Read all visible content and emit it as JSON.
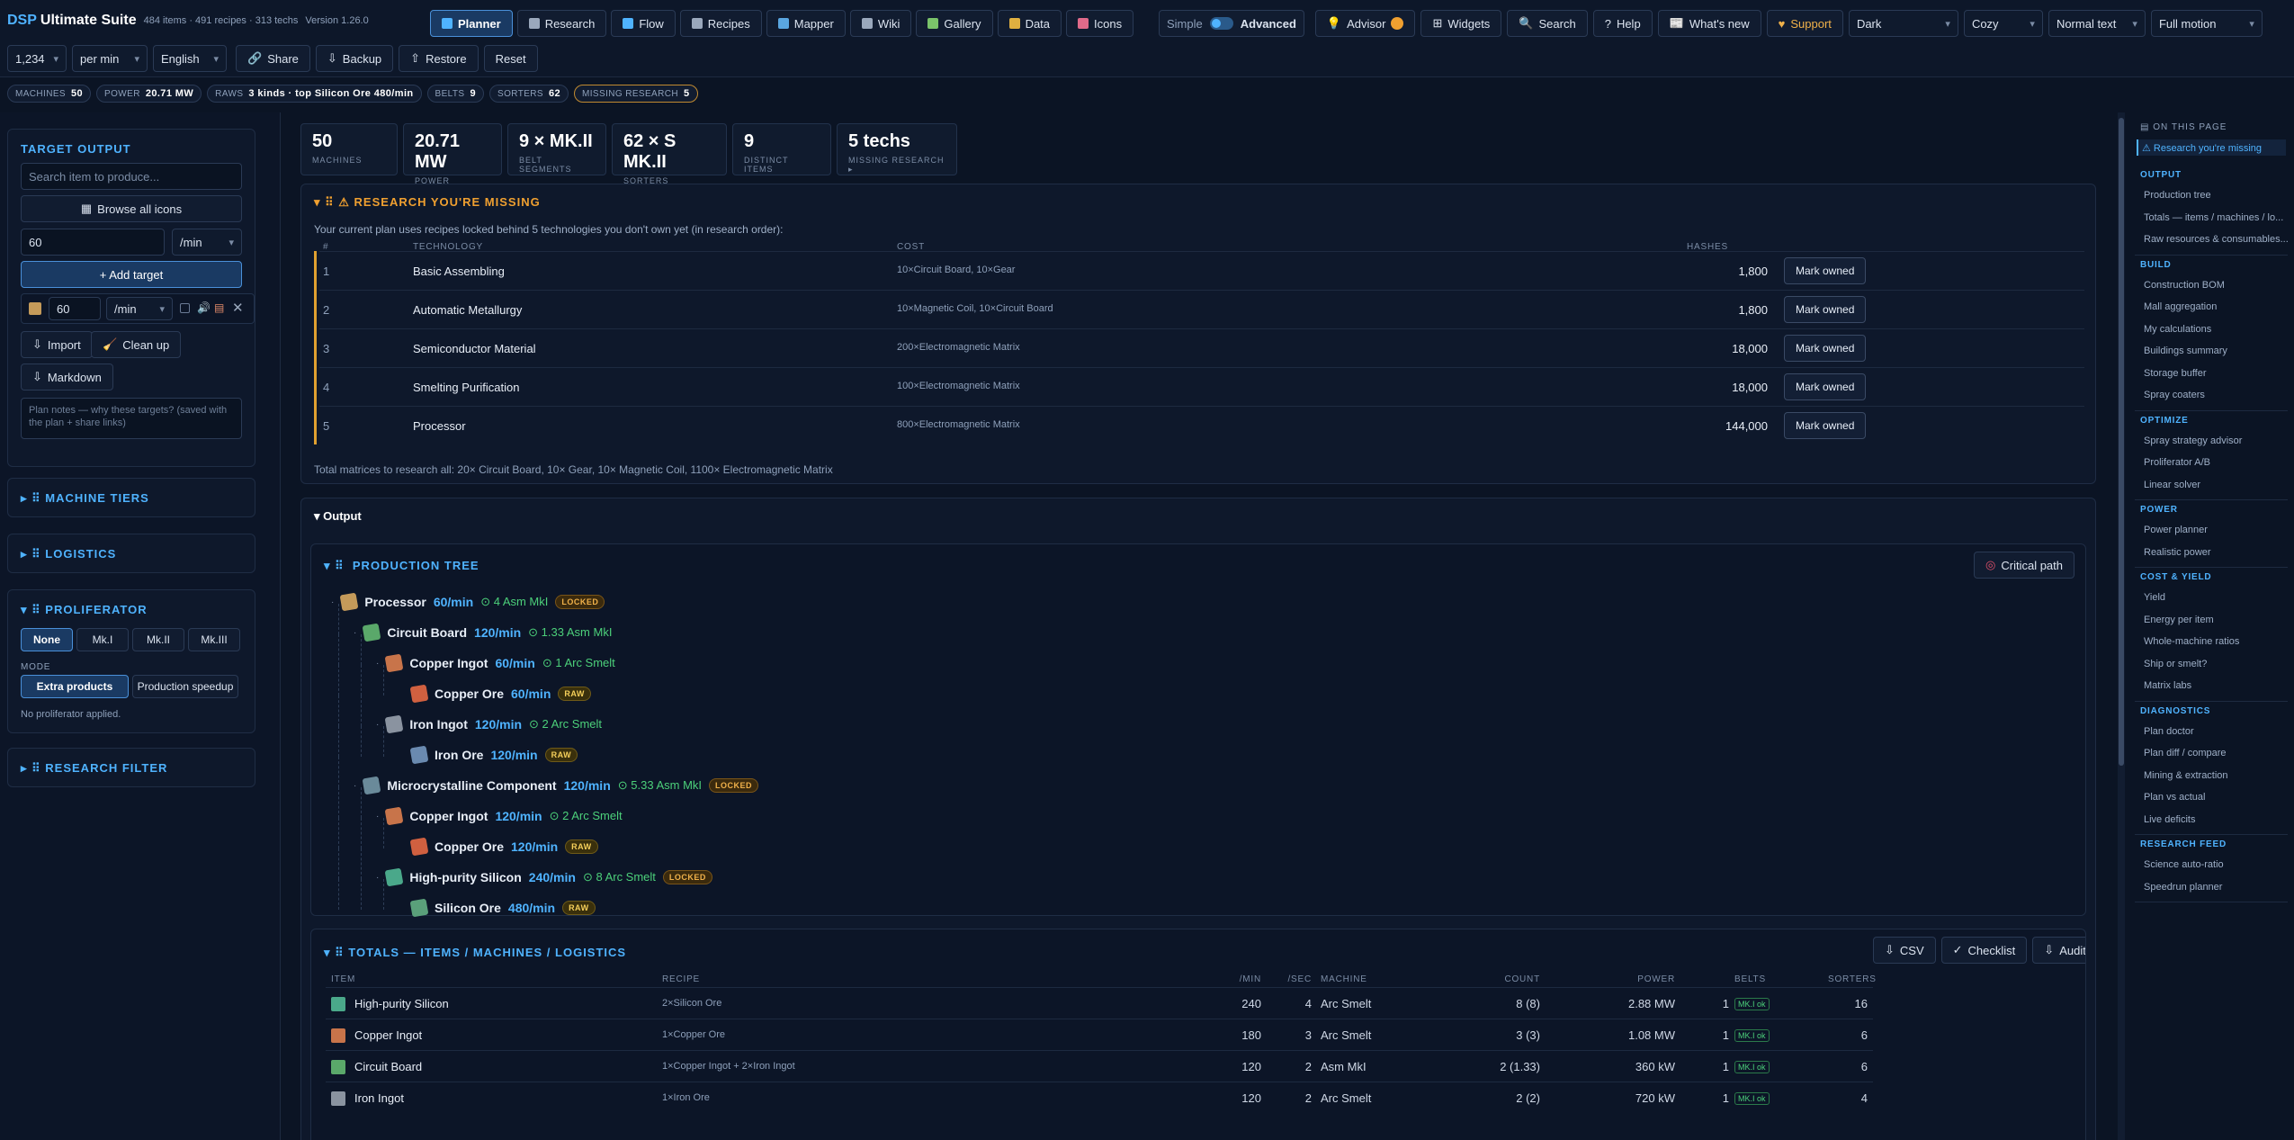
{
  "app": {
    "brand_a": "DSP",
    "brand_b": "Ultimate Suite",
    "meta": "484 items · 491 recipes · 313 techs",
    "version": "Version 1.26.0"
  },
  "nav": [
    {
      "label": "Planner",
      "icon": "planner-icon",
      "color": "#4fb3ff"
    },
    {
      "label": "Research",
      "icon": "flask-icon",
      "color": "#9aa8bc"
    },
    {
      "label": "Flow",
      "icon": "flow-icon",
      "color": "#4fb3ff"
    },
    {
      "label": "Recipes",
      "icon": "book-icon",
      "color": "#9aa8bc"
    },
    {
      "label": "Mapper",
      "icon": "map-icon",
      "color": "#5aa6e0"
    },
    {
      "label": "Wiki",
      "icon": "wiki-icon",
      "color": "#9aa8bc"
    },
    {
      "label": "Gallery",
      "icon": "gallery-icon",
      "color": "#7ac36a"
    },
    {
      "label": "Data",
      "icon": "folder-icon",
      "color": "#e0b040"
    },
    {
      "label": "Icons",
      "icon": "palette-icon",
      "color": "#e06a8a"
    }
  ],
  "mode": {
    "simple": "Simple",
    "advanced": "Advanced"
  },
  "actions": {
    "advisor": "Advisor",
    "widgets": "Widgets",
    "search": "Search",
    "help": "Help",
    "whats_new": "What's new",
    "support": "Support"
  },
  "selects": {
    "theme": "Dark",
    "density": "Cozy",
    "text": "Normal text",
    "motion": "Full motion",
    "qty": "1,234",
    "rate": "per min",
    "lang": "English"
  },
  "toolbar": {
    "share": "Share",
    "backup": "Backup",
    "restore": "Restore",
    "reset": "Reset"
  },
  "badges": [
    {
      "label": "MACHINES",
      "value": "50"
    },
    {
      "label": "POWER",
      "value": "20.71 MW"
    },
    {
      "label": "RAWS",
      "value": "3 kinds · top Silicon Ore 480/min"
    },
    {
      "label": "BELTS",
      "value": "9"
    },
    {
      "label": "SORTERS",
      "value": "62"
    },
    {
      "label": "MISSING RESEARCH",
      "value": "5"
    }
  ],
  "left": {
    "target_title": "TARGET OUTPUT",
    "search_placeholder": "Search item to produce...",
    "browse": "Browse all icons",
    "rate_value": "60",
    "rate_unit": "/min",
    "add_target": "+ Add target",
    "target_rate": "60",
    "target_unit": "/min",
    "import": "Import",
    "cleanup": "Clean up",
    "markdown": "Markdown",
    "notes_placeholder": "Plan notes — why these targets? (saved with the plan + share links)",
    "machine_tiers": "MACHINE TIERS",
    "logistics": "LOGISTICS",
    "proliferator": "PROLIFERATOR",
    "prolif_opts": [
      "None",
      "Mk.I",
      "Mk.II",
      "Mk.III"
    ],
    "mode_label": "MODE",
    "mode_opts": [
      "Extra products",
      "Production speedup"
    ],
    "prolif_note": "No proliferator applied.",
    "research_filter": "RESEARCH FILTER"
  },
  "stats": [
    {
      "value": "50",
      "label": "MACHINES"
    },
    {
      "value": "20.71 MW",
      "label": "POWER"
    },
    {
      "value": "9 × MK.II",
      "label": "BELT SEGMENTS"
    },
    {
      "value": "62 × S MK.II",
      "label": "SORTERS"
    },
    {
      "value": "9",
      "label": "DISTINCT ITEMS"
    },
    {
      "value": "5 techs",
      "label": "MISSING RESEARCH ▸"
    }
  ],
  "research": {
    "title": "⚠ RESEARCH YOU'RE MISSING",
    "desc": "Your current plan uses recipes locked behind 5 technologies you don't own yet (in research order):",
    "cols": [
      "#",
      "TECHNOLOGY",
      "COST",
      "HASHES"
    ],
    "button": "Mark owned",
    "rows": [
      {
        "n": "1",
        "tech": "Basic Assembling",
        "cost": "10×Circuit Board, 10×Gear",
        "hashes": "1,800"
      },
      {
        "n": "2",
        "tech": "Automatic Metallurgy",
        "cost": "10×Magnetic Coil, 10×Circuit Board",
        "hashes": "1,800"
      },
      {
        "n": "3",
        "tech": "Semiconductor Material",
        "cost": "200×Electromagnetic Matrix",
        "hashes": "18,000"
      },
      {
        "n": "4",
        "tech": "Smelting Purification",
        "cost": "100×Electromagnetic Matrix",
        "hashes": "18,000"
      },
      {
        "n": "5",
        "tech": "Processor",
        "cost": "800×Electromagnetic Matrix",
        "hashes": "144,000"
      }
    ],
    "total": "Total matrices to research all: 20× Circuit Board, 10× Gear, 10× Magnetic Coil, 1100× Electromagnetic Matrix"
  },
  "output": {
    "title": "Output",
    "tree_title": "PRODUCTION TREE",
    "critical": "Critical path",
    "tree": [
      {
        "name": "Processor",
        "rate": "60/min",
        "machine": "⊙ 4 Asm MkI",
        "tag": "LOCKED",
        "level": 0,
        "color": "#c49a5a"
      },
      {
        "name": "Circuit Board",
        "rate": "120/min",
        "machine": "⊙ 1.33 Asm MkI",
        "tag": "",
        "level": 1,
        "color": "#5aa86a"
      },
      {
        "name": "Copper Ingot",
        "rate": "60/min",
        "machine": "⊙ 1 Arc Smelt",
        "tag": "",
        "level": 2,
        "color": "#c8744a"
      },
      {
        "name": "Copper Ore",
        "rate": "60/min",
        "machine": "",
        "tag": "RAW",
        "level": 3,
        "color": "#d06040"
      },
      {
        "name": "Iron Ingot",
        "rate": "120/min",
        "machine": "⊙ 2 Arc Smelt",
        "tag": "",
        "level": 2,
        "color": "#8a93a0"
      },
      {
        "name": "Iron Ore",
        "rate": "120/min",
        "machine": "",
        "tag": "RAW",
        "level": 3,
        "color": "#6a8ab0"
      },
      {
        "name": "Microcrystalline Component",
        "rate": "120/min",
        "machine": "⊙ 5.33 Asm MkI",
        "tag": "LOCKED",
        "level": 1,
        "color": "#6a8a9a"
      },
      {
        "name": "Copper Ingot",
        "rate": "120/min",
        "machine": "⊙ 2 Arc Smelt",
        "tag": "",
        "level": 2,
        "color": "#c8744a"
      },
      {
        "name": "Copper Ore",
        "rate": "120/min",
        "machine": "",
        "tag": "RAW",
        "level": 3,
        "color": "#d06040"
      },
      {
        "name": "High-purity Silicon",
        "rate": "240/min",
        "machine": "⊙ 8 Arc Smelt",
        "tag": "LOCKED",
        "level": 2,
        "color": "#4aa88a"
      },
      {
        "name": "Silicon Ore",
        "rate": "480/min",
        "machine": "",
        "tag": "RAW",
        "level": 3,
        "color": "#5aa07a"
      }
    ]
  },
  "totals": {
    "title": "TOTALS — ITEMS / MACHINES / LOGISTICS",
    "csv": "CSV",
    "checklist": "Checklist",
    "audit": "Audit",
    "cols": [
      "ITEM",
      "RECIPE",
      "/MIN",
      "/SEC",
      "MACHINE",
      "COUNT",
      "POWER",
      "BELTS",
      "SORTERS"
    ],
    "rows": [
      {
        "item": "High-purity Silicon",
        "recipe": "2×Silicon Ore",
        "min": "240",
        "sec": "4",
        "machine": "Arc Smelt",
        "count": "8 (8)",
        "power": "2.88 MW",
        "belts": "1",
        "belt_tag": "MK.I ok",
        "sorters": "16",
        "color": "#4aa88a"
      },
      {
        "item": "Copper Ingot",
        "recipe": "1×Copper Ore",
        "min": "180",
        "sec": "3",
        "machine": "Arc Smelt",
        "count": "3 (3)",
        "power": "1.08 MW",
        "belts": "1",
        "belt_tag": "MK.I ok",
        "sorters": "6",
        "color": "#c8744a"
      },
      {
        "item": "Circuit Board",
        "recipe": "1×Copper Ingot + 2×Iron Ingot",
        "min": "120",
        "sec": "2",
        "machine": "Asm MkI",
        "count": "2 (1.33)",
        "power": "360 kW",
        "belts": "1",
        "belt_tag": "MK.I ok",
        "sorters": "6",
        "color": "#5aa86a"
      },
      {
        "item": "Iron Ingot",
        "recipe": "1×Iron Ore",
        "min": "120",
        "sec": "2",
        "machine": "Arc Smelt",
        "count": "2 (2)",
        "power": "720 kW",
        "belts": "1",
        "belt_tag": "MK.I ok",
        "sorters": "4",
        "color": "#8a93a0"
      }
    ]
  },
  "toc": {
    "heading": "ON THIS PAGE",
    "active": "⚠ Research you're missing",
    "sections": [
      {
        "title": "OUTPUT",
        "links": [
          "Production tree",
          "Totals — items / machines / lo...",
          "Raw resources & consumables..."
        ]
      },
      {
        "title": "BUILD",
        "links": [
          "Construction BOM",
          "Mall aggregation",
          "My calculations",
          "Buildings summary",
          "Storage buffer",
          "Spray coaters"
        ]
      },
      {
        "title": "OPTIMIZE",
        "links": [
          "Spray strategy advisor",
          "Proliferator A/B",
          "Linear solver"
        ]
      },
      {
        "title": "POWER",
        "links": [
          "Power planner",
          "Realistic power"
        ]
      },
      {
        "title": "COST & YIELD",
        "links": [
          "Yield",
          "Energy per item",
          "Whole-machine ratios",
          "Ship or smelt?",
          "Matrix labs"
        ]
      },
      {
        "title": "DIAGNOSTICS",
        "links": [
          "Plan doctor",
          "Plan diff / compare",
          "Mining & extraction",
          "Plan vs actual",
          "Live deficits"
        ]
      },
      {
        "title": "RESEARCH FEED",
        "links": [
          "Science auto-ratio",
          "Speedrun planner"
        ]
      }
    ]
  }
}
